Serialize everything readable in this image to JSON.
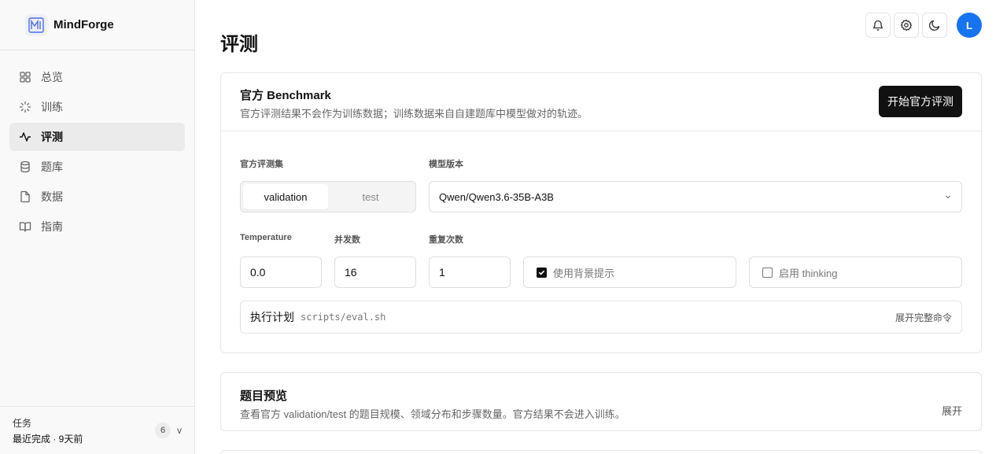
{
  "app": {
    "name": "MindForge"
  },
  "sidebar": {
    "items": [
      {
        "label": "总览",
        "icon": "grid-icon"
      },
      {
        "label": "训练",
        "icon": "loader-icon"
      },
      {
        "label": "评测",
        "icon": "activity-icon",
        "active": true
      },
      {
        "label": "题库",
        "icon": "database-icon"
      },
      {
        "label": "数据",
        "icon": "file-icon"
      },
      {
        "label": "指南",
        "icon": "book-open-icon"
      }
    ],
    "footer": {
      "label": "任务",
      "status": "最近完成 · 9天前",
      "count": "6",
      "toggle": "v"
    }
  },
  "header": {
    "avatar_initial": "L",
    "icons": [
      "bell-icon",
      "gear-icon",
      "moon-icon"
    ]
  },
  "page": {
    "title": "评测"
  },
  "benchmark": {
    "title": "官方 Benchmark",
    "description": "官方评测结果不会作为训练数据；训练数据来自自建题库中模型做对的轨迹。",
    "start_button": "开始官方评测",
    "dataset_label": "官方评测集",
    "dataset_options": [
      "validation",
      "test"
    ],
    "dataset_selected": "validation",
    "model_label": "模型版本",
    "model_value": "Qwen/Qwen3.6-35B-A3B",
    "temperature_label": "Temperature",
    "temperature_value": "0.0",
    "concurrency_label": "并发数",
    "concurrency_value": "16",
    "repeat_label": "重复次数",
    "repeat_value": "1",
    "background_hint_label": "使用背景提示",
    "background_hint_checked": true,
    "thinking_label": "启用 thinking",
    "thinking_checked": false,
    "plan_label": "执行计划",
    "plan_command": "scripts/eval.sh",
    "plan_toggle": "展开完整命令"
  },
  "preview": {
    "title": "题目预览",
    "description": "查看官方 validation/test 的题目规模、领域分布和步骤数量。官方结果不会进入训练。",
    "toggle": "展开"
  },
  "colors": {
    "accent": "#1674f0",
    "primary_button": "#111111",
    "active_nav": "#ebebeb"
  }
}
